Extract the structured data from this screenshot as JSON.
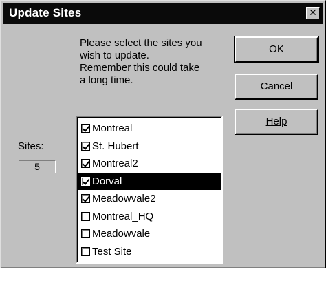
{
  "window": {
    "title": "Update Sites",
    "close_glyph": "✕"
  },
  "instructions": "Please select the sites you\nwish to update.\nRemember this could take\na long time.",
  "buttons": {
    "ok": "OK",
    "cancel": "Cancel",
    "help": "Help"
  },
  "sites": {
    "label": "Sites:",
    "count": "5"
  },
  "list": {
    "items": [
      {
        "label": "Montreal",
        "checked": true,
        "selected": false
      },
      {
        "label": "St. Hubert",
        "checked": true,
        "selected": false
      },
      {
        "label": "Montreal2",
        "checked": true,
        "selected": false
      },
      {
        "label": "Dorval",
        "checked": true,
        "selected": true
      },
      {
        "label": "Meadowvale2",
        "checked": true,
        "selected": false
      },
      {
        "label": "Montreal_HQ",
        "checked": false,
        "selected": false
      },
      {
        "label": "Meadowvale",
        "checked": false,
        "selected": false
      },
      {
        "label": "Test Site",
        "checked": false,
        "selected": false
      }
    ]
  },
  "colors": {
    "dialog_bg": "#c0c0c0",
    "titlebar": "#0a0a0a",
    "selection": "#000000"
  }
}
